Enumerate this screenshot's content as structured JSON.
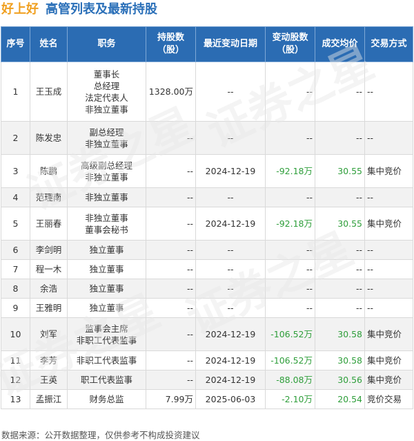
{
  "title": {
    "company": "好上好",
    "heading": "高管列表及最新持股"
  },
  "table": {
    "headers": [
      "序号",
      "姓名",
      "职务",
      "持股数\n（股）",
      "最近变动日期",
      "变动股数\n（股）",
      "成交均价",
      "交易方式"
    ],
    "rows": [
      {
        "idx": "1",
        "name": "王玉成",
        "positions": [
          "董事长",
          "总经理",
          "法定代表人",
          "非独立董事"
        ],
        "shares": "1328.00万",
        "date": "--",
        "change": "--",
        "price": "--",
        "type": "--"
      },
      {
        "idx": "2",
        "name": "陈发忠",
        "positions": [
          "副总经理",
          "非独立董事"
        ],
        "shares": "--",
        "date": "--",
        "change": "--",
        "price": "--",
        "type": "--"
      },
      {
        "idx": "3",
        "name": "陈鹏",
        "positions": [
          "高级副总经理",
          "非独立董事"
        ],
        "shares": "--",
        "date": "2024-12-19",
        "change": "-92.18万",
        "price": "30.55",
        "type": "集中竞价"
      },
      {
        "idx": "4",
        "name": "范理南",
        "positions": [
          "非独立董事"
        ],
        "shares": "--",
        "date": "--",
        "change": "--",
        "price": "--",
        "type": "--"
      },
      {
        "idx": "5",
        "name": "王丽春",
        "positions": [
          "非独立董事",
          "董事会秘书"
        ],
        "shares": "--",
        "date": "2024-12-19",
        "change": "-92.18万",
        "price": "30.55",
        "type": "集中竞价"
      },
      {
        "idx": "6",
        "name": "李剑明",
        "positions": [
          "独立董事"
        ],
        "shares": "--",
        "date": "--",
        "change": "--",
        "price": "--",
        "type": "--"
      },
      {
        "idx": "7",
        "name": "程一木",
        "positions": [
          "独立董事"
        ],
        "shares": "--",
        "date": "--",
        "change": "--",
        "price": "--",
        "type": "--"
      },
      {
        "idx": "8",
        "name": "余浩",
        "positions": [
          "独立董事"
        ],
        "shares": "--",
        "date": "--",
        "change": "--",
        "price": "--",
        "type": "--"
      },
      {
        "idx": "9",
        "name": "王雅明",
        "positions": [
          "独立董事"
        ],
        "shares": "--",
        "date": "--",
        "change": "--",
        "price": "--",
        "type": "--"
      },
      {
        "idx": "10",
        "name": "刘军",
        "positions": [
          "监事会主席",
          "非职工代表监事"
        ],
        "shares": "--",
        "date": "2024-12-19",
        "change": "-106.52万",
        "price": "30.58",
        "type": "集中竞价"
      },
      {
        "idx": "11",
        "name": "李芳",
        "positions": [
          "非职工代表监事"
        ],
        "shares": "--",
        "date": "2024-12-19",
        "change": "-106.52万",
        "price": "30.58",
        "type": "集中竞价"
      },
      {
        "idx": "12",
        "name": "王英",
        "positions": [
          "职工代表监事"
        ],
        "shares": "--",
        "date": "2024-12-19",
        "change": "-88.08万",
        "price": "30.56",
        "type": "集中竞价"
      },
      {
        "idx": "13",
        "name": "孟振江",
        "positions": [
          "财务总监"
        ],
        "shares": "7.99万",
        "date": "2025-06-03",
        "change": "-2.10万",
        "price": "20.54",
        "type": "竞价交易"
      }
    ]
  },
  "footer": "数据来源：公开数据整理，仅供参考不构成投资建议",
  "watermark": "证券之星",
  "colors": {
    "header_bg": "#2b6cb3",
    "title_blue": "#2a6fb8",
    "company_orange": "#f0a020",
    "positive_green": "#2e9e3a"
  }
}
